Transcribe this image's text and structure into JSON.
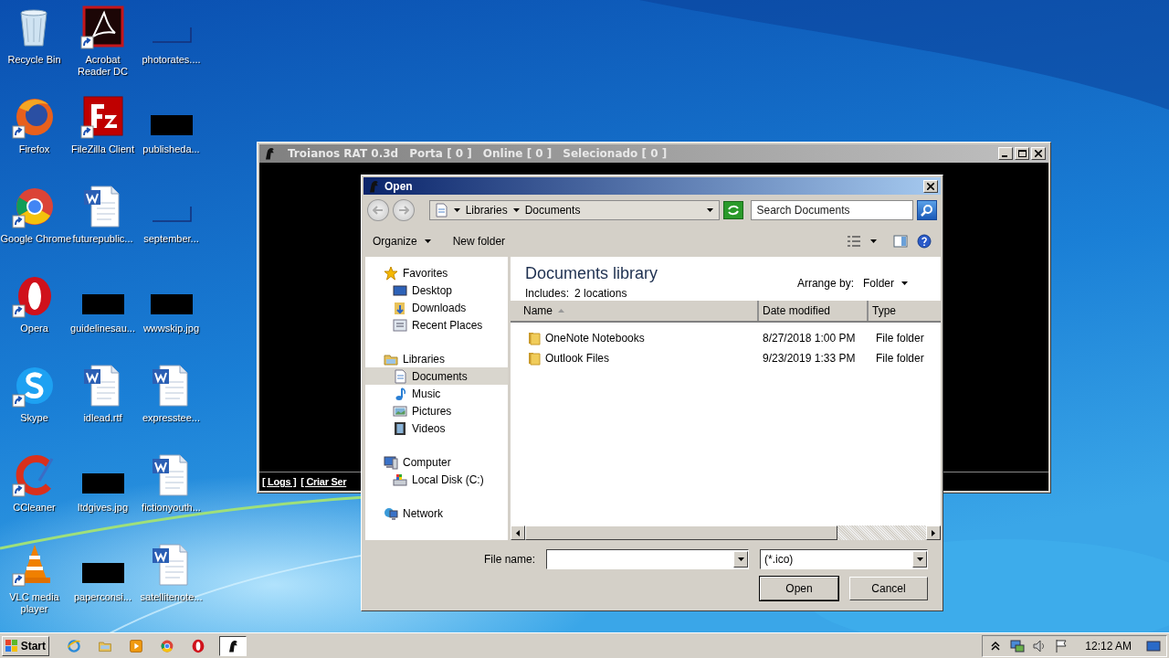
{
  "desktop": {
    "icons": [
      {
        "label": "Recycle Bin",
        "kind": "recycle",
        "shortcut": false
      },
      {
        "label": "Acrobat Reader DC",
        "kind": "pdf",
        "shortcut": true
      },
      {
        "label": "photorates....",
        "kind": "blank",
        "shortcut": false
      },
      {
        "label": "Firefox",
        "kind": "firefox",
        "shortcut": true
      },
      {
        "label": "FileZilla Client",
        "kind": "filezilla",
        "shortcut": true
      },
      {
        "label": "publisheda...",
        "kind": "redacted",
        "shortcut": false
      },
      {
        "label": "Google Chrome",
        "kind": "chrome",
        "shortcut": true
      },
      {
        "label": "futurepublic...",
        "kind": "word",
        "shortcut": false
      },
      {
        "label": "september...",
        "kind": "blank",
        "shortcut": false
      },
      {
        "label": "Opera",
        "kind": "opera",
        "shortcut": true
      },
      {
        "label": "guidelinesau...",
        "kind": "redacted",
        "shortcut": false
      },
      {
        "label": "wwwskip.jpg",
        "kind": "redacted",
        "shortcut": false
      },
      {
        "label": "Skype",
        "kind": "skype",
        "shortcut": true
      },
      {
        "label": "idlead.rtf",
        "kind": "word",
        "shortcut": false
      },
      {
        "label": "expresstee...",
        "kind": "word",
        "shortcut": false
      },
      {
        "label": "CCleaner",
        "kind": "ccleaner",
        "shortcut": true
      },
      {
        "label": "ltdgives.jpg",
        "kind": "redacted",
        "shortcut": false
      },
      {
        "label": "fictionyouth...",
        "kind": "word",
        "shortcut": false
      },
      {
        "label": "VLC media player",
        "kind": "vlc",
        "shortcut": true
      },
      {
        "label": "paperconsi...",
        "kind": "redacted",
        "shortcut": false
      },
      {
        "label": "satellitenote...",
        "kind": "word",
        "shortcut": false
      }
    ]
  },
  "rat_window": {
    "title": "Troianos RAT 0.3d",
    "status": [
      "Porta [ 0 ]",
      "Online [ 0 ]",
      "Selecionado [ 0 ]"
    ],
    "menu": [
      "[ Logs ]",
      "[ Criar Ser"
    ]
  },
  "dialog": {
    "title": "Open",
    "breadcrumb": [
      "Libraries",
      "Documents"
    ],
    "search": {
      "placeholder": "Search Documents"
    },
    "toolbar": {
      "organize": "Organize",
      "new_folder": "New folder"
    },
    "nav": [
      {
        "label": "Favorites",
        "kind": "star",
        "selected": false,
        "children": [
          {
            "label": "Desktop",
            "kind": "desktop",
            "selected": false
          },
          {
            "label": "Downloads",
            "kind": "downloads",
            "selected": false
          },
          {
            "label": "Recent Places",
            "kind": "recent",
            "selected": false
          }
        ]
      },
      {
        "label": "Libraries",
        "kind": "libraries",
        "selected": false,
        "children": [
          {
            "label": "Documents",
            "kind": "documents",
            "selected": true
          },
          {
            "label": "Music",
            "kind": "music",
            "selected": false
          },
          {
            "label": "Pictures",
            "kind": "pictures",
            "selected": false
          },
          {
            "label": "Videos",
            "kind": "videos",
            "selected": false
          }
        ]
      },
      {
        "label": "Computer",
        "kind": "computer",
        "selected": false,
        "children": [
          {
            "label": "Local Disk (C:)",
            "kind": "disk",
            "selected": false
          }
        ]
      },
      {
        "label": "Network",
        "kind": "network",
        "selected": false
      }
    ],
    "library": {
      "title": "Documents library",
      "includes_label": "Includes:",
      "includes_value": "2 locations",
      "arrange_label": "Arrange by:",
      "arrange_value": "Folder"
    },
    "columns": [
      {
        "label": "Name",
        "sorted": true
      },
      {
        "label": "Date modified",
        "sorted": false
      },
      {
        "label": "Type",
        "sorted": false
      }
    ],
    "rows": [
      {
        "name": "OneNote Notebooks",
        "date": "8/27/2018 1:00 PM",
        "type": "File folder"
      },
      {
        "name": "Outlook Files",
        "date": "9/23/2019 1:33 PM",
        "type": "File folder"
      }
    ],
    "file_name_label": "File name:",
    "file_type": "(*.ico)",
    "buttons": [
      "Open",
      "Cancel"
    ]
  },
  "taskbar": {
    "start": "Start",
    "items": [
      {
        "kind": "ie",
        "selected": false
      },
      {
        "kind": "explorer",
        "selected": false
      },
      {
        "kind": "media",
        "selected": false
      },
      {
        "kind": "chrome",
        "selected": false
      },
      {
        "kind": "opera",
        "selected": false
      },
      {
        "kind": "rat",
        "selected": true
      }
    ],
    "clock": "12:12 AM"
  }
}
